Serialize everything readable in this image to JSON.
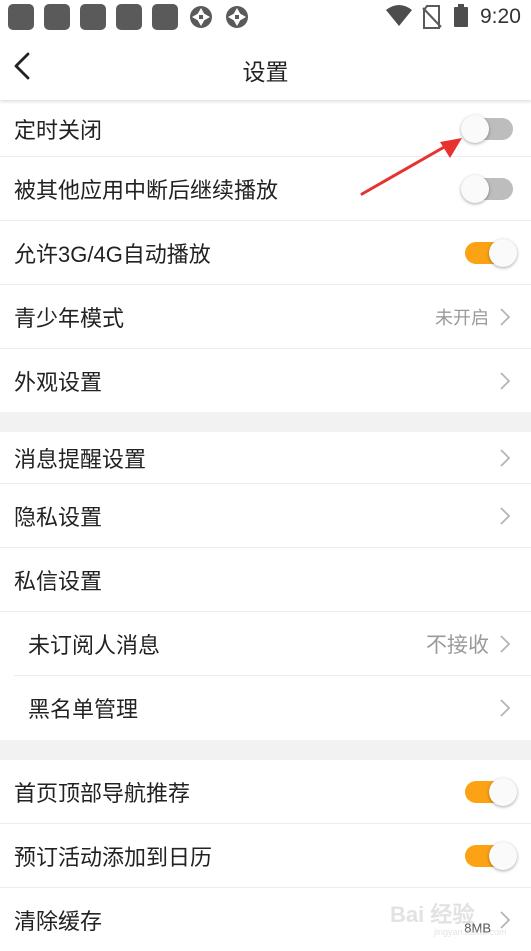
{
  "status_bar": {
    "time": "9:20",
    "notification_icons": [
      "app-icon",
      "app-icon",
      "app-icon",
      "app-icon",
      "app-icon",
      "aperture-icon",
      "aperture-icon"
    ],
    "indicator_icons": [
      "wifi-icon",
      "no-sim-icon",
      "battery-icon"
    ]
  },
  "header": {
    "title": "设置",
    "back_icon": "chevron-left-icon"
  },
  "settings": {
    "scheduled_close": {
      "label": "定时关闭",
      "toggle": "off"
    },
    "resume_after_interrupt": {
      "label": "被其他应用中断后继续播放",
      "toggle": "off"
    },
    "allow_mobile_autoplay": {
      "label": "允许3G/4G自动播放",
      "toggle": "on"
    },
    "teen_mode": {
      "label": "青少年模式",
      "value": "未开启"
    },
    "appearance": {
      "label": "外观设置"
    },
    "notifications": {
      "label": "消息提醒设置"
    },
    "privacy": {
      "label": "隐私设置"
    },
    "dm_settings": {
      "label": "私信设置"
    },
    "unsubscribed_messages": {
      "label": "未订阅人消息",
      "value": "不接收"
    },
    "blacklist": {
      "label": "黑名单管理"
    },
    "home_top_nav": {
      "label": "首页顶部导航推荐",
      "toggle": "on"
    },
    "add_to_calendar": {
      "label": "预订活动添加到日历",
      "toggle": "on"
    },
    "clear_cache": {
      "label": "清除缓存",
      "value": "8MB"
    }
  },
  "annotation": {
    "arrow_color": "#e8322f"
  },
  "colors": {
    "toggle_on": "#fba314",
    "toggle_off": "#bdbdbd",
    "section_gap": "#f2f2f2"
  },
  "watermark": {
    "text": "Bai 经验",
    "sub": "jingyan.baidu.com"
  }
}
